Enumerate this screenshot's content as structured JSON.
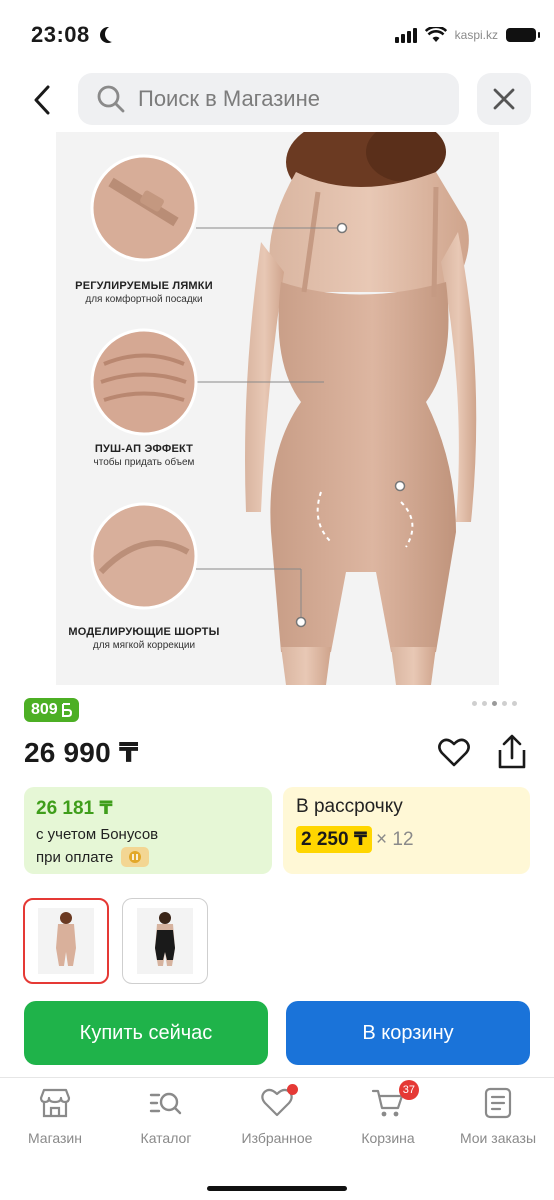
{
  "status_bar": {
    "time": "23:08",
    "url": "kaspi.kz"
  },
  "search": {
    "placeholder": "Поиск в Магазине"
  },
  "product_image": {
    "features": [
      {
        "title": "РЕГУЛИРУЕМЫЕ ЛЯМКИ",
        "subtitle": "для комфортной посадки"
      },
      {
        "title": "ПУШ-АП ЭФФЕКТ",
        "subtitle": "чтобы придать объем"
      },
      {
        "title": "МОДЕЛИРУЮЩИЕ ШОРТЫ",
        "subtitle": "для мягкой коррекции"
      }
    ],
    "gallery_dots": 5,
    "active_dot": 3
  },
  "bonus_badge": {
    "value": "809",
    "currency_icon": "bonus-b-icon"
  },
  "price": {
    "value": "26 990 ₸"
  },
  "bonus_card": {
    "amount": "26 181 ₸",
    "line1": "с учетом Бонусов",
    "line2": "при оплате"
  },
  "installment_card": {
    "title": "В рассрочку",
    "monthly": "2 250 ₸",
    "multiplier": "× 12"
  },
  "thumbnails": [
    {
      "color": "beige",
      "selected": true
    },
    {
      "color": "black",
      "selected": false
    }
  ],
  "actions": {
    "buy_now": "Купить сейчас",
    "add_to_cart": "В корзину"
  },
  "bottom_nav": {
    "items": [
      {
        "label": "Магазин",
        "icon": "store-icon"
      },
      {
        "label": "Каталог",
        "icon": "catalog-search-icon"
      },
      {
        "label": "Избранное",
        "icon": "heart-icon",
        "dot": true
      },
      {
        "label": "Корзина",
        "icon": "cart-icon",
        "badge": "37"
      },
      {
        "label": "Мои заказы",
        "icon": "orders-icon"
      }
    ]
  },
  "colors": {
    "green_button": "#1fb34a",
    "blue_button": "#1a73d9",
    "bonus_green": "#4caf24",
    "badge_red": "#e53935",
    "installment_yellow": "#ffd600"
  }
}
